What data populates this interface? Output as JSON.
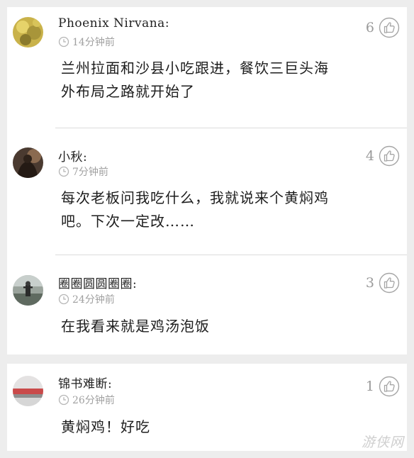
{
  "comments": [
    {
      "author": "Phoenix Nirvana:",
      "time": "14分钟前",
      "text_lines": [
        "兰州拉面和沙县小吃跟进，餐饮三巨头海",
        "外布局之路就开始了"
      ],
      "likes": "6",
      "avatar_icon": "yellow-pattern-avatar"
    },
    {
      "author": "小秋:",
      "time": "7分钟前",
      "text_lines": [
        "每次老板问我吃什么，我就说来个黄焖鸡",
        "吧。下次一定改……"
      ],
      "likes": "4",
      "avatar_icon": "dark-figure-avatar"
    },
    {
      "author": "圈圈圆圆圈圈:",
      "time": "24分钟前",
      "text_lines": [
        "在我看来就是鸡汤泡饭"
      ],
      "likes": "3",
      "avatar_icon": "person-outdoors-avatar"
    },
    {
      "author": "锦书难断:",
      "time": "26分钟前",
      "text_lines": [
        "黄焖鸡！好吃"
      ],
      "likes": "1",
      "avatar_icon": "landscape-avatar"
    }
  ],
  "watermark": "游侠网",
  "colors": {
    "background": "#ededed",
    "card": "#ffffff",
    "meta_gray": "#a0a0a0",
    "text": "#1d1d1d"
  }
}
